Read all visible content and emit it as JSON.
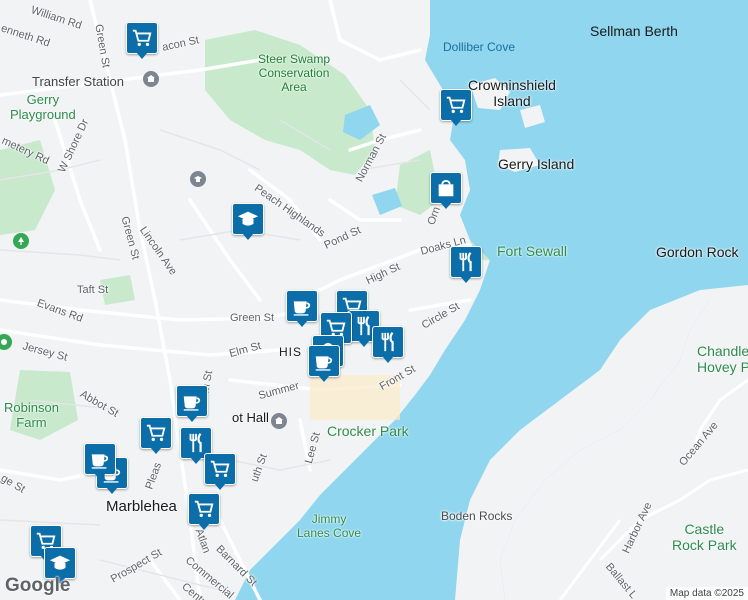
{
  "map": {
    "colors": {
      "land": "#f1f3f4",
      "water": "#8fd6ee",
      "park": "#c8e9cc",
      "road": "#ffffff",
      "road_outline": "#dadce0",
      "pin": "#0b6ea8"
    },
    "labels": {
      "sellman_berth": "Sellman Berth",
      "dolliber_cove": "Dolliber Cove",
      "crowninshield": "Crowninshield\nIsland",
      "gerry_island": "Gerry Island",
      "fort_sewall": "Fort Sewall",
      "gordon_rock": "Gordon Rock",
      "chandler_hovey": "Chandle\nHovey Pa",
      "crocker_park": "Crocker Park",
      "boden_rocks": "Boden Rocks",
      "jimmy_lanes_cove": "Jimmy\nLanes Cove",
      "castle_rock": "Castle\nRock Park",
      "steer_swamp": "Steer Swamp\nConservation\nArea",
      "transfer_station": "Transfer Station",
      "gerry_playground": "Gerry\nPlayground",
      "robinson_farm": "Robinson\nFarm",
      "marblehead": "Marblehea",
      "historic": "HIS",
      "abbot_hall": "ot Hall"
    },
    "streets": {
      "william_rd": "William Rd",
      "kenneth_rd": "enneth Rd",
      "green_st_n": "Green St",
      "bacon_st": "acon St",
      "w_shore_dr": "W Shore Dr",
      "cemetery_rd": "metery Rd",
      "green_st_w": "Green St",
      "lincoln_ave": "Lincoln Ave",
      "peach_highlands": "Peach Highlands",
      "norman_st": "Norman St",
      "pond_st": "Pond St",
      "orne": "Orn",
      "doaks_ln": "Doaks Ln",
      "high_st": "High St",
      "taft_st": "Taft St",
      "evans_rd": "Evans Rd",
      "green_st_c": "Green St",
      "circle_st": "Circle St",
      "jersey_st": "Jersey St",
      "elm_st": "Elm St",
      "summer": "Summer",
      "abbot_st": "Abbot St",
      "front_st": "Front St",
      "lee_st": "Lee St",
      "pleasant": "Pleas",
      "south_st": "uth St",
      "ge_st": "ge St",
      "atlantic": "Atlan",
      "barnard_st": "Barnard St",
      "prospect_st": "Prospect St",
      "commercial": "Commercial",
      "harbor_ave": "Harbor Ave",
      "ocean_ave": "Ocean Ave",
      "ballast": "Ballast L",
      "centr": "Centr",
      "m_st": "m St"
    },
    "pins": [
      {
        "kind": "shopping-cart-icon"
      },
      {
        "kind": "shopping-cart-icon"
      },
      {
        "kind": "shopping-bag-icon"
      },
      {
        "kind": "restaurant-icon"
      },
      {
        "kind": "school-icon"
      },
      {
        "kind": "cafe-icon"
      },
      {
        "kind": "shopping-cart-icon"
      },
      {
        "kind": "restaurant-icon"
      },
      {
        "kind": "shopping-cart-icon"
      },
      {
        "kind": "restaurant-icon"
      },
      {
        "kind": "shopping-bag-icon"
      },
      {
        "kind": "cafe-icon"
      },
      {
        "kind": "cafe-icon"
      },
      {
        "kind": "shopping-cart-icon"
      },
      {
        "kind": "restaurant-icon"
      },
      {
        "kind": "shopping-cart-icon"
      },
      {
        "kind": "cafe-icon"
      },
      {
        "kind": "cafe-icon"
      },
      {
        "kind": "shopping-cart-icon"
      },
      {
        "kind": "shopping-cart-icon"
      },
      {
        "kind": "school-icon"
      }
    ],
    "logo": "Google",
    "credit": "Map data ©2025"
  }
}
